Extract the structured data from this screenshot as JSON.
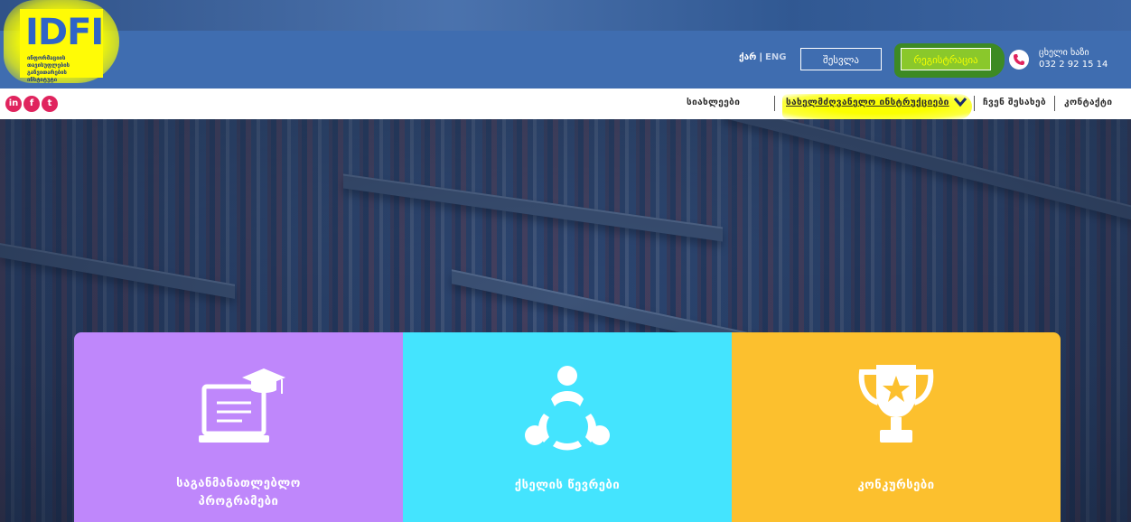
{
  "logo": {
    "text": "IDFI",
    "subtitle": "ინფორმაციის თავისუფლების განვითარების ინსტიტუტი"
  },
  "header": {
    "lang_active": "ქარ",
    "lang_inactive": "ENG",
    "login_label": "შესვლა",
    "register_label": "რეგისტრაცია",
    "hotline_title": "ცხელი ხაზი",
    "hotline_number": "032 2 92 15 14"
  },
  "social": [
    {
      "label": "in",
      "icon": "linkedin-icon"
    },
    {
      "label": "f",
      "icon": "facebook-icon"
    },
    {
      "label": "t",
      "icon": "twitter-icon"
    }
  ],
  "nav": [
    {
      "label": "სიახლეები"
    },
    {
      "label": "სახელმძღვანელო ინსტრუქციები"
    },
    {
      "label": "ჩვენ შესახებ"
    },
    {
      "label": "კონტაქტი"
    }
  ],
  "tiles": [
    {
      "label_line1": "საგანმანათლებლო",
      "label_line2": "პროგრამები",
      "icon": "education-laptop-icon",
      "color": "#bf87fb"
    },
    {
      "label_line1": "ქსელის წევრები",
      "label_line2": "",
      "icon": "network-members-icon",
      "color": "#44e4fe"
    },
    {
      "label_line1": "კონკურსები",
      "label_line2": "",
      "icon": "trophy-icon",
      "color": "#fcc02e"
    }
  ],
  "colors": {
    "header_bg": "#3f6db0",
    "highlight": "#fbff00",
    "register_bg": "#8ac82b",
    "social": "#e0245e"
  }
}
